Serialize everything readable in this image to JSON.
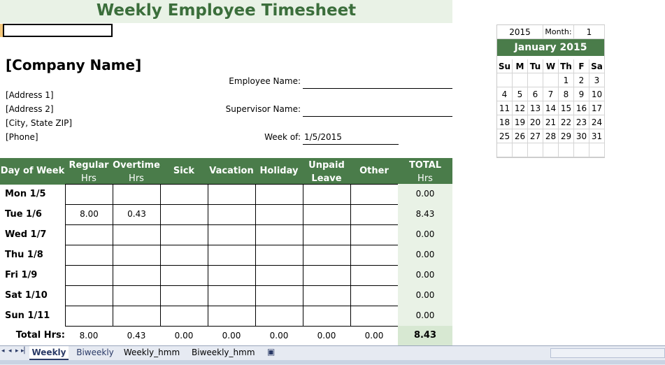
{
  "title": "Weekly Employee Timesheet",
  "company": {
    "name": "[Company Name]",
    "address1": "[Address 1]",
    "address2": "[Address 2]",
    "city": "[City, State  ZIP]",
    "phone": "[Phone]"
  },
  "fields": {
    "employee_label": "Employee Name:",
    "supervisor_label": "Supervisor Name:",
    "week_label": "Week of:",
    "week_value": "1/5/2015"
  },
  "table": {
    "headers": [
      {
        "line1": "Day of Week",
        "line2": ""
      },
      {
        "line1": "Regular",
        "line2": "Hrs"
      },
      {
        "line1": "Overtime",
        "line2": "Hrs"
      },
      {
        "line1": "Sick",
        "line2": ""
      },
      {
        "line1": "Vacation",
        "line2": ""
      },
      {
        "line1": "Holiday",
        "line2": ""
      },
      {
        "line1": "Unpaid",
        "line2": "Leave"
      },
      {
        "line1": "Other",
        "line2": ""
      },
      {
        "line1": "TOTAL",
        "line2": "Hrs"
      }
    ],
    "rows": [
      {
        "day": "Mon 1/5",
        "cells": [
          "",
          "",
          "",
          "",
          "",
          "",
          ""
        ],
        "total": "0.00"
      },
      {
        "day": "Tue 1/6",
        "cells": [
          "8.00",
          "0.43",
          "",
          "",
          "",
          "",
          ""
        ],
        "total": "8.43"
      },
      {
        "day": "Wed 1/7",
        "cells": [
          "",
          "",
          "",
          "",
          "",
          "",
          ""
        ],
        "total": "0.00"
      },
      {
        "day": "Thu 1/8",
        "cells": [
          "",
          "",
          "",
          "",
          "",
          "",
          ""
        ],
        "total": "0.00"
      },
      {
        "day": "Fri 1/9",
        "cells": [
          "",
          "",
          "",
          "",
          "",
          "",
          ""
        ],
        "total": "0.00"
      },
      {
        "day": "Sat 1/10",
        "cells": [
          "",
          "",
          "",
          "",
          "",
          "",
          ""
        ],
        "total": "0.00"
      },
      {
        "day": "Sun 1/11",
        "cells": [
          "",
          "",
          "",
          "",
          "",
          "",
          ""
        ],
        "total": "0.00"
      }
    ],
    "totals_label": "Total Hrs:",
    "totals": [
      "8.00",
      "0.43",
      "0.00",
      "0.00",
      "0.00",
      "0.00",
      "0.00"
    ],
    "grand_total": "8.43"
  },
  "calendar": {
    "year": "2015",
    "month_label": "Month:",
    "month": "1",
    "header": "January 2015",
    "weekdays": [
      "Su",
      "M",
      "Tu",
      "W",
      "Th",
      "F",
      "Sa"
    ],
    "weeks": [
      [
        "",
        "",
        "",
        "",
        "1",
        "2",
        "3"
      ],
      [
        "4",
        "5",
        "6",
        "7",
        "8",
        "9",
        "10"
      ],
      [
        "11",
        "12",
        "13",
        "14",
        "15",
        "16",
        "17"
      ],
      [
        "18",
        "19",
        "20",
        "21",
        "22",
        "23",
        "24"
      ],
      [
        "25",
        "26",
        "27",
        "28",
        "29",
        "30",
        "31"
      ],
      [
        "",
        "",
        "",
        "",
        "",
        "",
        ""
      ]
    ]
  },
  "tabs": [
    {
      "label": "Weekly",
      "active": true
    },
    {
      "label": "Biweekly",
      "active": false
    },
    {
      "label": "Weekly_hmm",
      "active": false
    },
    {
      "label": "Biweekly_hmm",
      "active": false
    }
  ],
  "colors": {
    "header_green": "#4a7c4a",
    "title_green": "#3b6e3b",
    "light_green": "#e9f2e6"
  }
}
